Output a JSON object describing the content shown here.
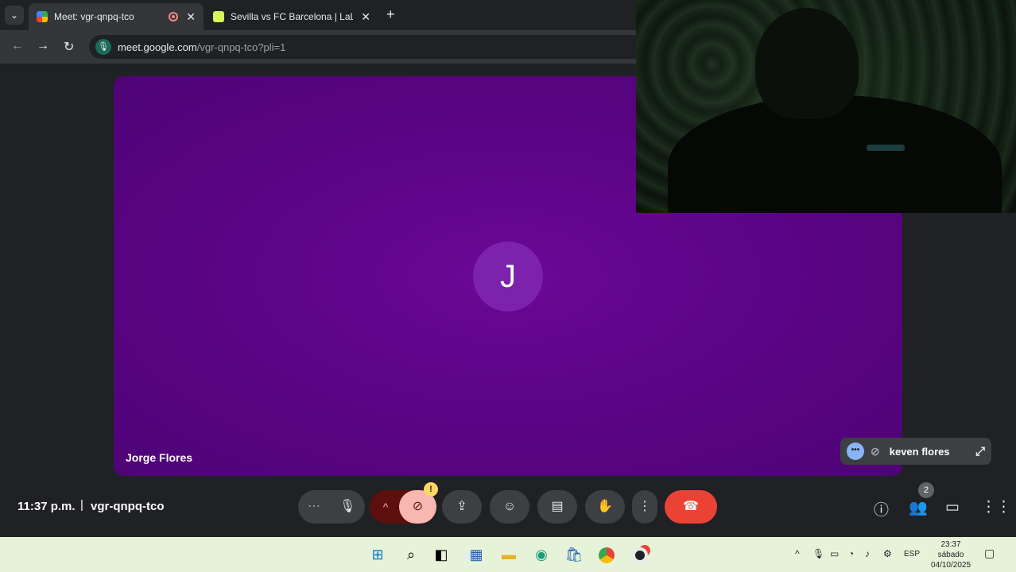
{
  "browser": {
    "tabs": [
      {
        "title": "Meet: vgr-qnpq-tco",
        "recording": true
      },
      {
        "title": "Sevilla vs FC Barcelona | LaLiga"
      }
    ],
    "url_host": "meet.google.com",
    "url_path": "/vgr-qnpq-tco?pli=1"
  },
  "meet": {
    "main_tile": {
      "initial": "J",
      "name": "Jorge Flores",
      "color": "#5a0484"
    },
    "mini_tile": {
      "name": "keven flores"
    },
    "time": "11:37 p.m.",
    "separator": "|",
    "meeting_code": "vgr-qnpq-tco",
    "people_count": "2",
    "camera_warning": "!"
  },
  "taskbar": {
    "lang": "ESP",
    "clock_time": "23:37",
    "clock_day": "sábado",
    "clock_date": "04/10/2025"
  },
  "icons": {
    "tab_list": "chevron-down-icon",
    "back": "arrow-left-icon",
    "forward": "arrow-right-icon",
    "reload": "reload-icon",
    "mic": "microphone-icon",
    "camera_off": "camera-off-icon",
    "present": "present-screen-icon",
    "emoji": "emoji-icon",
    "captions": "captions-icon",
    "hand": "raise-hand-icon",
    "more": "more-vert-icon",
    "end_call": "end-call-icon",
    "info": "info-icon",
    "people": "people-icon",
    "chat": "chat-icon",
    "activities": "apps-grid-icon"
  },
  "colors": {
    "end_call": "#ea4335",
    "camera_off_bg": "#f9b7b1",
    "accent": "#8ab4f8"
  }
}
